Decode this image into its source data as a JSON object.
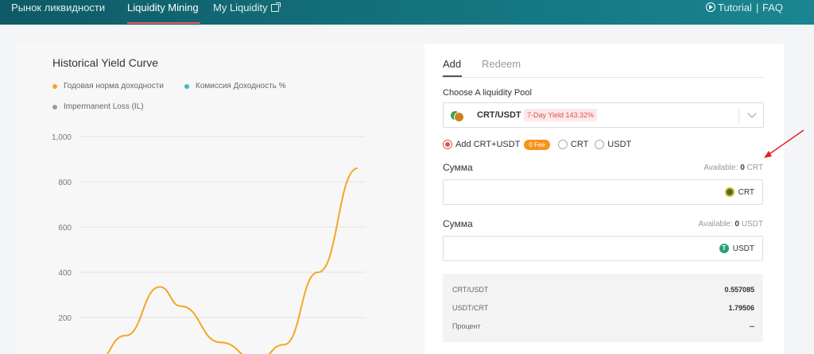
{
  "nav": {
    "items": [
      "Рынок ликвидности",
      "Liquidity Mining",
      "My Liquidity"
    ],
    "tutorial": "Tutorial",
    "separator": "|",
    "faq": "FAQ"
  },
  "chart": {
    "title": "Historical Yield Curve",
    "legend": [
      {
        "label": "Годовая норма доходности",
        "color": "#f5a623"
      },
      {
        "label": "Комиссия Доходность %",
        "color": "#3fb8bf"
      },
      {
        "label": "Impermanent Loss (IL)",
        "color": "#9b9b9b"
      }
    ]
  },
  "chart_data": {
    "type": "line",
    "yticks": [
      "1,000",
      "800",
      "600",
      "400",
      "200"
    ],
    "ylim": [
      0,
      1000
    ],
    "series": [
      {
        "name": "Годовая норма доходности",
        "color": "#f5a623",
        "points": [
          [
            0.0,
            -10
          ],
          [
            0.12,
            120
          ],
          [
            0.25,
            335
          ],
          [
            0.33,
            250
          ],
          [
            0.48,
            90
          ],
          [
            0.62,
            10
          ],
          [
            0.72,
            80
          ],
          [
            0.85,
            400
          ],
          [
            1.0,
            860
          ]
        ]
      }
    ]
  },
  "panel": {
    "tabs": [
      "Add",
      "Redeem"
    ],
    "pool_label": "Choose A liquidity Pool",
    "pool_name": "CRT/USDT",
    "yield_badge": "7-Day Yield 143.32%",
    "radio_options": [
      "Add CRT+USDT",
      "CRT",
      "USDT"
    ],
    "fee_badge": "0 Fee",
    "amount1": {
      "label": "Сумма",
      "available_prefix": "Available:",
      "available_value": "0",
      "available_unit": "CRT",
      "coin": "CRT"
    },
    "amount2": {
      "label": "Сумма",
      "available_prefix": "Available:",
      "available_value": "0",
      "available_unit": "USDT",
      "coin": "USDT"
    },
    "info": [
      {
        "label": "CRT/USDT",
        "value": "0.557085"
      },
      {
        "label": "USDT/CRT",
        "value": "1.79506"
      },
      {
        "label": "Процент",
        "value": "--"
      }
    ]
  },
  "colors": {
    "accent": "#d9534f",
    "crt_coin": "#2e7d32",
    "usdt_coin": "#26a17b",
    "fee": "#f7931a"
  }
}
